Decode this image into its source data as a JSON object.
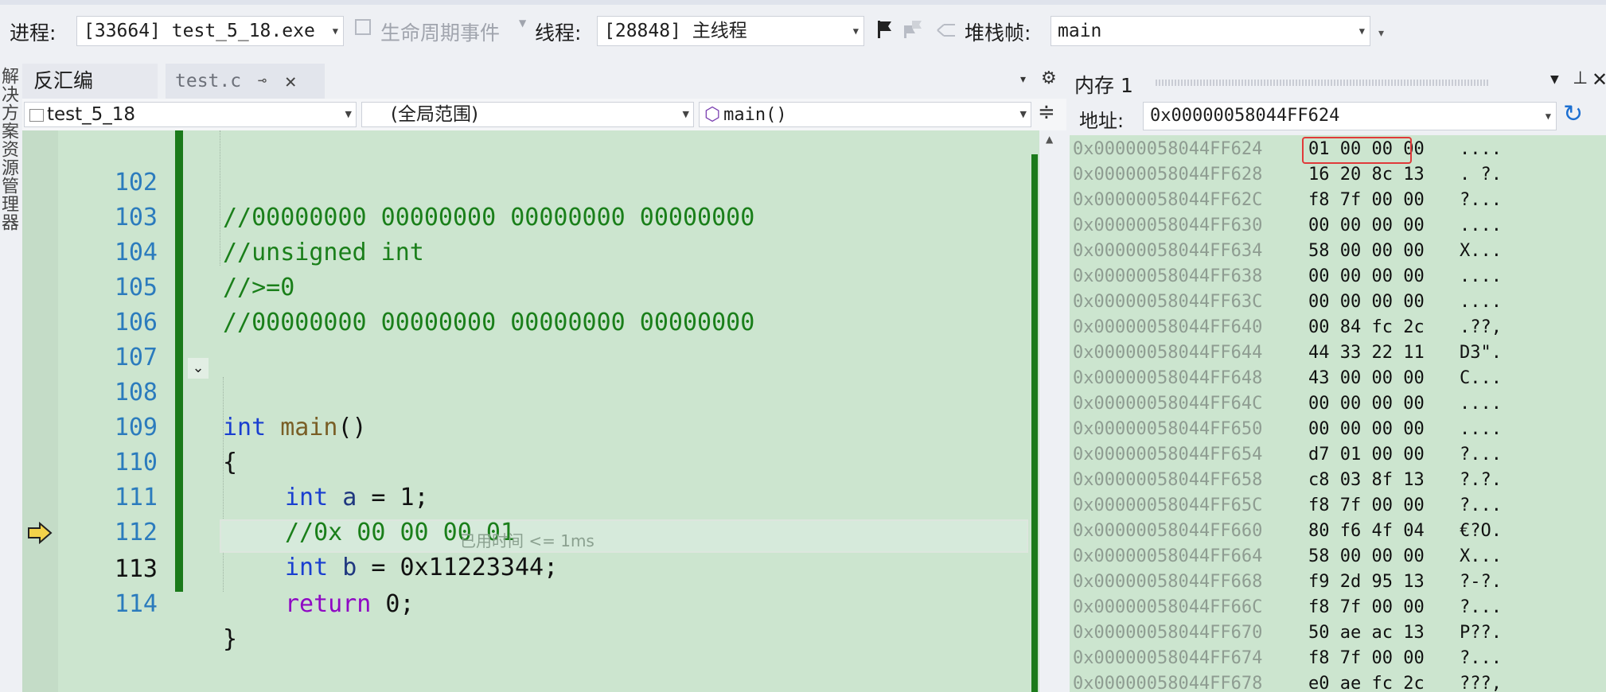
{
  "toolbar": {
    "process_label": "进程:",
    "process_value": "[33664] test_5_18.exe",
    "lifecycle_label": "生命周期事件",
    "thread_label": "线程:",
    "thread_value": "[28848] 主线程",
    "stackframe_label": "堆栈帧:",
    "stackframe_value": "main"
  },
  "sidebar": {
    "label": "解决方案资源管理器"
  },
  "tabs": [
    {
      "label": "反汇编"
    },
    {
      "label": "test.c"
    }
  ],
  "nav": {
    "project": "test_5_18",
    "scope": "(全局范围)",
    "member": "main()"
  },
  "editor": {
    "lines": [
      {
        "num": "102",
        "text": "//00000000 00000000 00000000 00000000"
      },
      {
        "num": "103",
        "text": "//unsigned int"
      },
      {
        "num": "104",
        "text": "//>=0"
      },
      {
        "num": "105",
        "text": "//00000000 00000000 00000000 00000000"
      },
      {
        "num": "106",
        "text": ""
      },
      {
        "num": "107",
        "text": ""
      },
      {
        "num": "108",
        "kw": "int",
        "fn": "main",
        "rest": "()"
      },
      {
        "num": "109",
        "text": "{"
      },
      {
        "num": "110",
        "kw": "int",
        "id": "a",
        "rest": " = 1;"
      },
      {
        "num": "111",
        "text": "//0x 00 00 00 01"
      },
      {
        "num": "112",
        "kw": "int",
        "id": "b",
        "rest": " = 0x11223344;"
      },
      {
        "num": "113",
        "kw": "return",
        "rest": " 0;"
      },
      {
        "num": "114",
        "text": "}"
      }
    ],
    "elapsed": "已用时间 <= 1ms"
  },
  "memory": {
    "title": "内存 1",
    "address_label": "地址:",
    "address_value": "0x00000058044FF624",
    "rows": [
      {
        "addr": "0x00000058044FF624",
        "bytes": "01 00 00 00",
        "ascii": "...."
      },
      {
        "addr": "0x00000058044FF628",
        "bytes": "16 20 8c 13",
        "ascii": ". ?."
      },
      {
        "addr": "0x00000058044FF62C",
        "bytes": "f8 7f 00 00",
        "ascii": "?..."
      },
      {
        "addr": "0x00000058044FF630",
        "bytes": "00 00 00 00",
        "ascii": "...."
      },
      {
        "addr": "0x00000058044FF634",
        "bytes": "58 00 00 00",
        "ascii": "X..."
      },
      {
        "addr": "0x00000058044FF638",
        "bytes": "00 00 00 00",
        "ascii": "...."
      },
      {
        "addr": "0x00000058044FF63C",
        "bytes": "00 00 00 00",
        "ascii": "...."
      },
      {
        "addr": "0x00000058044FF640",
        "bytes": "00 84 fc 2c",
        "ascii": ".??,"
      },
      {
        "addr": "0x00000058044FF644",
        "bytes": "44 33 22 11",
        "ascii": "D3\"."
      },
      {
        "addr": "0x00000058044FF648",
        "bytes": "43 00 00 00",
        "ascii": "C..."
      },
      {
        "addr": "0x00000058044FF64C",
        "bytes": "00 00 00 00",
        "ascii": "...."
      },
      {
        "addr": "0x00000058044FF650",
        "bytes": "00 00 00 00",
        "ascii": "...."
      },
      {
        "addr": "0x00000058044FF654",
        "bytes": "d7 01 00 00",
        "ascii": "?..."
      },
      {
        "addr": "0x00000058044FF658",
        "bytes": "c8 03 8f 13",
        "ascii": "?.?."
      },
      {
        "addr": "0x00000058044FF65C",
        "bytes": "f8 7f 00 00",
        "ascii": "?..."
      },
      {
        "addr": "0x00000058044FF660",
        "bytes": "80 f6 4f 04",
        "ascii": "€?O."
      },
      {
        "addr": "0x00000058044FF664",
        "bytes": "58 00 00 00",
        "ascii": "X..."
      },
      {
        "addr": "0x00000058044FF668",
        "bytes": "f9 2d 95 13",
        "ascii": "?-?."
      },
      {
        "addr": "0x00000058044FF66C",
        "bytes": "f8 7f 00 00",
        "ascii": "?..."
      },
      {
        "addr": "0x00000058044FF670",
        "bytes": "50 ae ac 13",
        "ascii": "P??."
      },
      {
        "addr": "0x00000058044FF674",
        "bytes": "f8 7f 00 00",
        "ascii": "?..."
      },
      {
        "addr": "0x00000058044FF678",
        "bytes": "e0 ae fc 2c",
        "ascii": "???,"
      }
    ]
  },
  "colors": {
    "editor_bg": "#cce5cf",
    "change_bar": "#1a7a1a",
    "keyword": "#1a3fd0",
    "comment": "#1a7f1a",
    "highlight": "#e03a3a"
  },
  "icons": [
    "flag-icon",
    "thread-flag-icon",
    "stack-icon",
    "refresh-icon",
    "pin-icon",
    "close-icon",
    "breakpoint-arrow-icon",
    "collapse-icon"
  ]
}
